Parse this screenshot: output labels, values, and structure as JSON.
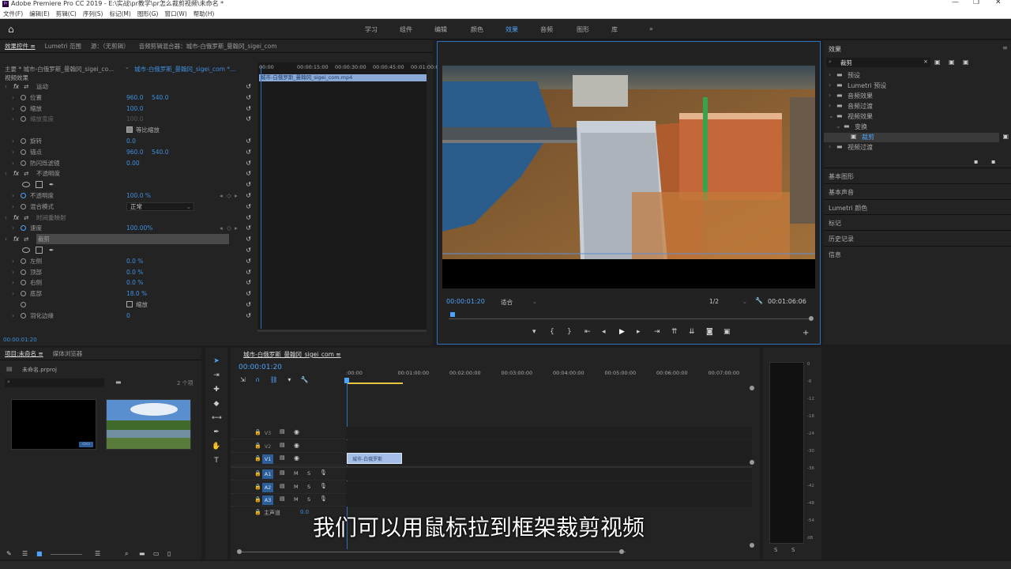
{
  "app": {
    "title": "Adobe Premiere Pro CC 2019 - E:\\实战\\pr教学\\pr怎么裁剪视频\\未命名 *",
    "logo": "Pr"
  },
  "menu": [
    "文件(F)",
    "编辑(E)",
    "剪辑(C)",
    "序列(S)",
    "标记(M)",
    "图形(G)",
    "窗口(W)",
    "帮助(H)"
  ],
  "workspaces": [
    {
      "label": "学习"
    },
    {
      "label": "组件"
    },
    {
      "label": "编辑"
    },
    {
      "label": "颜色"
    },
    {
      "label": "效果",
      "active": true
    },
    {
      "label": "音频"
    },
    {
      "label": "图形"
    },
    {
      "label": "库"
    },
    {
      "label": "»"
    }
  ],
  "effect_controls": {
    "tabs": [
      "效果控件 ≡",
      "Lumetri 范围",
      "源：（无剪辑）",
      "音频剪辑混合器：城市-白俄罗斯_曼翰冈_sigei_com"
    ],
    "master": "主要 * 城市-白俄罗斯_曼翰冈_sigei_co...",
    "clip_ref": "城市-白俄罗斯_曼翰冈_sigei_com *...",
    "section": "视频效果",
    "timeline_times": [
      "00:00",
      "00:00:15:00",
      "00:00:30:00",
      "00:00:45:00",
      "00:01:00:00"
    ],
    "clip_bar": "城市-白俄罗斯_曼翰冈_sigei_com.mp4",
    "rows": [
      {
        "label": "运动",
        "indent": 0,
        "fx": true
      },
      {
        "label": "位置",
        "indent": 1,
        "v1": "960.0",
        "v2": "540.0"
      },
      {
        "label": "缩放",
        "indent": 1,
        "v1": "100.0"
      },
      {
        "label": "缩放宽度",
        "indent": 1,
        "v1": "100.0",
        "dim": true
      },
      {
        "label": "等比缩放",
        "indent": 2,
        "check": true
      },
      {
        "label": "旋转",
        "indent": 1,
        "v1": "0.0"
      },
      {
        "label": "锚点",
        "indent": 1,
        "v1": "960.0",
        "v2": "540.0"
      },
      {
        "label": "防闪烁滤镜",
        "indent": 1,
        "v1": "0.00"
      },
      {
        "label": "不透明度",
        "indent": 0,
        "fx": true
      },
      {
        "label": "",
        "indent": 1,
        "masks": true
      },
      {
        "label": "不透明度",
        "indent": 1,
        "v1": "100.0 %",
        "kf": true
      },
      {
        "label": "混合模式",
        "indent": 1,
        "select": "正常"
      },
      {
        "label": "时间重映射",
        "indent": 0,
        "fx": true,
        "dim": true
      },
      {
        "label": "速度",
        "indent": 1,
        "v1": "100.00%",
        "kf": true
      },
      {
        "label": "裁剪",
        "indent": 0,
        "fx": true,
        "highlight": true
      },
      {
        "label": "",
        "indent": 1,
        "masks": true
      },
      {
        "label": "左侧",
        "indent": 1,
        "v1": "0.0 %"
      },
      {
        "label": "顶部",
        "indent": 1,
        "v1": "0.0 %"
      },
      {
        "label": "右侧",
        "indent": 1,
        "v1": "0.0 %"
      },
      {
        "label": "底部",
        "indent": 1,
        "v1": "18.0 %"
      },
      {
        "label": "缩放",
        "indent": 2,
        "check": true,
        "box": true
      },
      {
        "label": "羽化边缘",
        "indent": 1,
        "v1": "0"
      }
    ],
    "footer_time": "00:00:01:20"
  },
  "program": {
    "timecode": "00:00:01:20",
    "fit": "适合",
    "resolution": "1/2",
    "duration": "00:01:06:06"
  },
  "effects_panel": {
    "title": "效果",
    "search_value": "裁剪",
    "tree": [
      {
        "label": "预设",
        "level": 0
      },
      {
        "label": "Lumetri 预设",
        "level": 0
      },
      {
        "label": "音频效果",
        "level": 0
      },
      {
        "label": "音频过渡",
        "level": 0
      },
      {
        "label": "视频效果",
        "level": 0,
        "open": true
      },
      {
        "label": "变换",
        "level": 1,
        "open": true
      },
      {
        "label": "裁剪",
        "level": 2,
        "selected": true
      },
      {
        "label": "视频过渡",
        "level": 0
      }
    ],
    "panels": [
      "基本图形",
      "基本声音",
      "Lumetri 颜色",
      "标记",
      "历史记录",
      "信息"
    ]
  },
  "project": {
    "tabs": [
      "项目:未命名 ≡",
      "媒体浏览器"
    ],
    "file": "未命名.prproj",
    "count": "2 个项"
  },
  "timeline": {
    "tab": "城市-白俄罗斯_曼翰冈_sigei_com ≡",
    "timecode": "00:00:01:20",
    "ruler": [
      ":00:00",
      "00:01:00:00",
      "00:02:00:00",
      "00:03:00:00",
      "00:04:00:00",
      "00:05:00:00",
      "00:06:00:00",
      "00:07:00:00"
    ],
    "video_tracks": [
      "V3",
      "V2",
      "V1"
    ],
    "audio_tracks": [
      "A1",
      "A2",
      "A3"
    ],
    "master": "主声道",
    "master_value": "0.0",
    "clip_label": "城市-白俄罗斯"
  },
  "meter": {
    "scale": [
      "0",
      "-6",
      "-12",
      "-18",
      "-24",
      "-30",
      "-36",
      "-42",
      "-48",
      "-54",
      "dB"
    ],
    "buttons": [
      "S",
      "S"
    ]
  },
  "subtitle": "我们可以用鼠标拉到框架裁剪视频"
}
